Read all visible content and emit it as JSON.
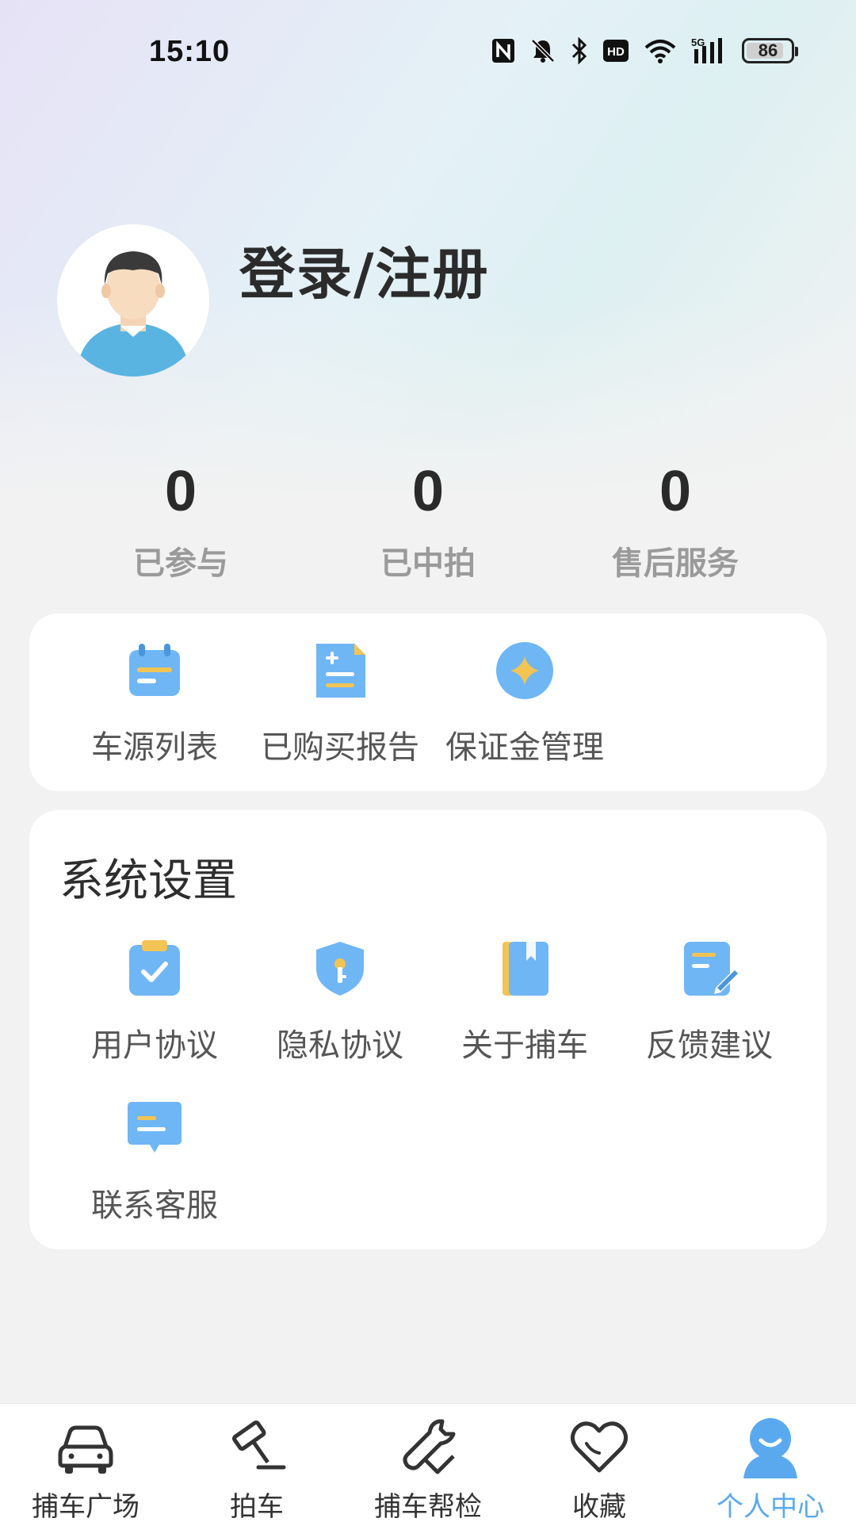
{
  "status_bar": {
    "time": "15:10",
    "battery": "86",
    "battery_level": 0.86,
    "icons": [
      "nfc-icon",
      "bell-muted-icon",
      "bluetooth-icon",
      "hd-icon",
      "wifi-icon",
      "signal-5g-icon",
      "battery-icon"
    ]
  },
  "profile": {
    "login_label": "登录/注册",
    "avatar_icon": "avatar-man-icon"
  },
  "stats": [
    {
      "value": "0",
      "label": "已参与"
    },
    {
      "value": "0",
      "label": "已中拍"
    },
    {
      "value": "0",
      "label": "售后服务"
    }
  ],
  "quick_actions": [
    {
      "label": "车源列表",
      "icon": "calendar-list-icon"
    },
    {
      "label": "已购买报告",
      "icon": "report-doc-icon"
    },
    {
      "label": "保证金管理",
      "icon": "deposit-coin-icon"
    }
  ],
  "settings": {
    "title": "系统设置",
    "items": [
      {
        "label": "用户协议",
        "icon": "clipboard-check-icon"
      },
      {
        "label": "隐私协议",
        "icon": "shield-key-icon"
      },
      {
        "label": "关于捕车",
        "icon": "book-icon"
      },
      {
        "label": "反馈建议",
        "icon": "edit-note-icon"
      },
      {
        "label": "联系客服",
        "icon": "chat-bubble-icon"
      }
    ]
  },
  "bottom_nav": [
    {
      "label": "捕车广场",
      "icon": "car-icon",
      "active": false
    },
    {
      "label": "拍车",
      "icon": "auction-gavel-icon",
      "active": false
    },
    {
      "label": "捕车帮检",
      "icon": "wrench-icon",
      "active": false
    },
    {
      "label": "收藏",
      "icon": "heart-icon",
      "active": false
    },
    {
      "label": "个人中心",
      "icon": "person-icon",
      "active": true
    }
  ],
  "colors": {
    "accent": "#5aa9ee",
    "icon_blue": "#6fb6f5",
    "icon_gold": "#f2c454",
    "background": "#f2f2f2"
  }
}
